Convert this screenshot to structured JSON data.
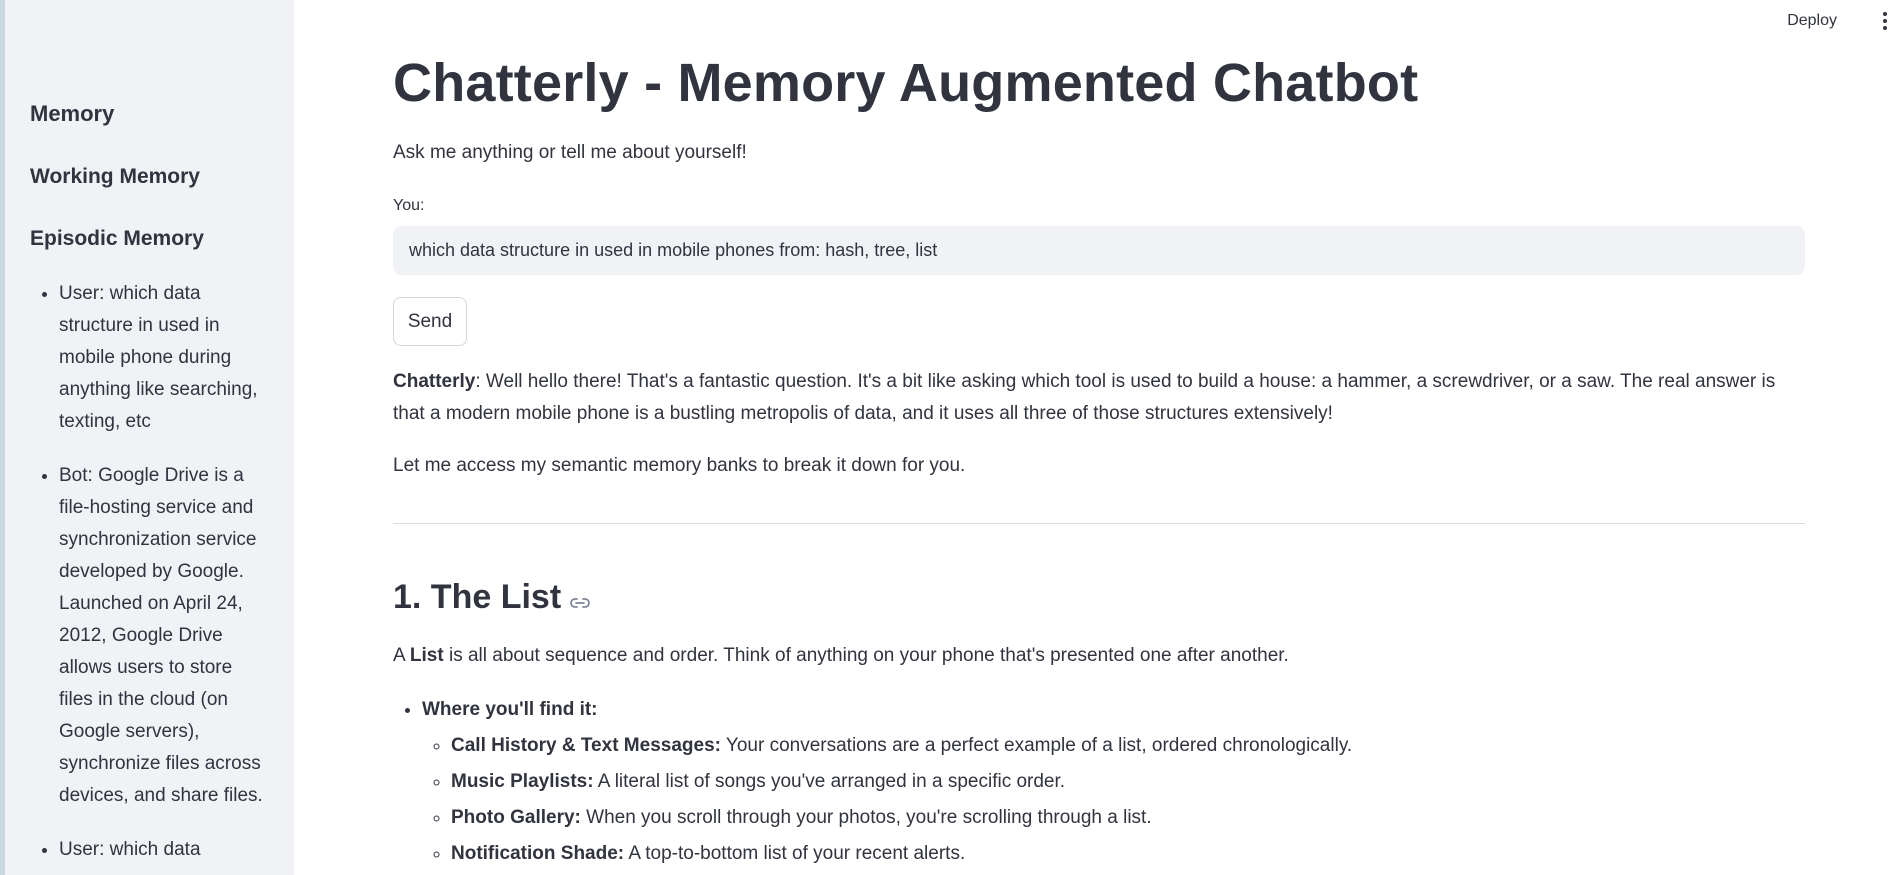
{
  "header": {
    "deploy_label": "Deploy"
  },
  "sidebar": {
    "headings": {
      "memory": "Memory",
      "working_memory": "Working Memory",
      "episodic_memory": "Episodic Memory"
    },
    "episodic_items": [
      "User: which data structure in used in mobile phone during anything like searching, texting, etc",
      "Bot: Google Drive is a file-hosting service and synchronization service developed by Google. Launched on April 24, 2012, Google Drive allows users to store files in the cloud (on Google servers), synchronize files across devices, and share files.",
      "User: which data"
    ]
  },
  "main": {
    "title": "Chatterly - Memory Augmented Chatbot",
    "subtitle": "Ask me anything or tell me about yourself!",
    "input_label": "You:",
    "input_value": "which data structure in used in mobile phones from: hash, tree, list",
    "send_label": "Send",
    "response": {
      "speaker": "Chatterly",
      "intro": ": Well hello there! That's a fantastic question. It's a bit like asking which tool is used to build a house: a hammer, a screwdriver, or a saw. The real answer is that a modern mobile phone is a bustling metropolis of data, and it uses all three of those structures extensively!",
      "para2": "Let me access my semantic memory banks to break it down for you.",
      "section_title": "1. The List",
      "list_intro_a": "A ",
      "list_intro_b": "List",
      "list_intro_c": " is all about sequence and order. Think of anything on your phone that's presented one after another.",
      "where_label": "Where you'll find it:",
      "examples": [
        {
          "term": "Call History & Text Messages:",
          "desc": " Your conversations are a perfect example of a list, ordered chronologically."
        },
        {
          "term": "Music Playlists:",
          "desc": " A literal list of songs you've arranged in a specific order."
        },
        {
          "term": "Photo Gallery:",
          "desc": " When you scroll through your photos, you're scrolling through a list."
        },
        {
          "term": "Notification Shade:",
          "desc": " A top-to-bottom list of your recent alerts."
        }
      ]
    }
  }
}
